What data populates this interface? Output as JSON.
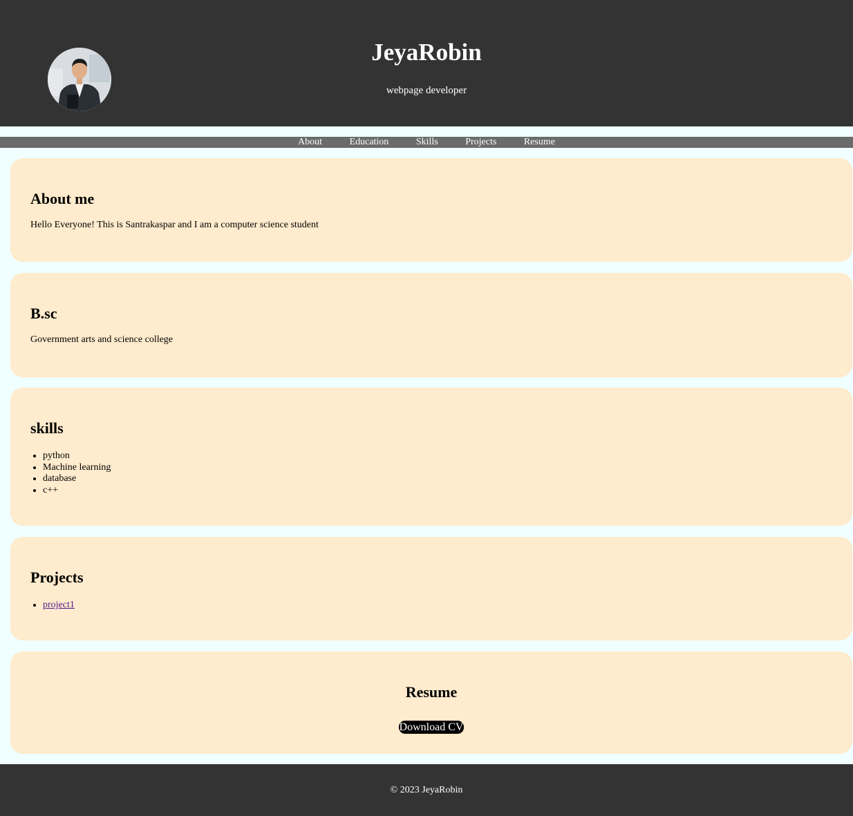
{
  "header": {
    "title": "JeyaRobin",
    "subtitle": "webpage developer",
    "avatar_icon": "profile-photo"
  },
  "nav": {
    "items": [
      "About",
      "Education",
      "Skills",
      "Projects",
      "Resume"
    ]
  },
  "about": {
    "heading": "About me",
    "text": "Hello Everyone! This is Santrakaspar and I am a computer science student"
  },
  "education": {
    "heading": "B.sc",
    "text": "Government arts and science college"
  },
  "skills": {
    "heading": "skills",
    "items": [
      "python",
      "Machine learning",
      "database",
      "c++"
    ]
  },
  "projects": {
    "heading": "Projects",
    "items": [
      "project1"
    ]
  },
  "resume": {
    "heading": "Resume",
    "button_label": "Download CV"
  },
  "footer": {
    "text": "© 2023 JeyaRobin"
  },
  "colors": {
    "header_bg": "#333333",
    "nav_bg": "#6b6b6b",
    "page_bg": "#f0ffff",
    "card_bg": "#ffebcd",
    "link": "#551a8b"
  }
}
